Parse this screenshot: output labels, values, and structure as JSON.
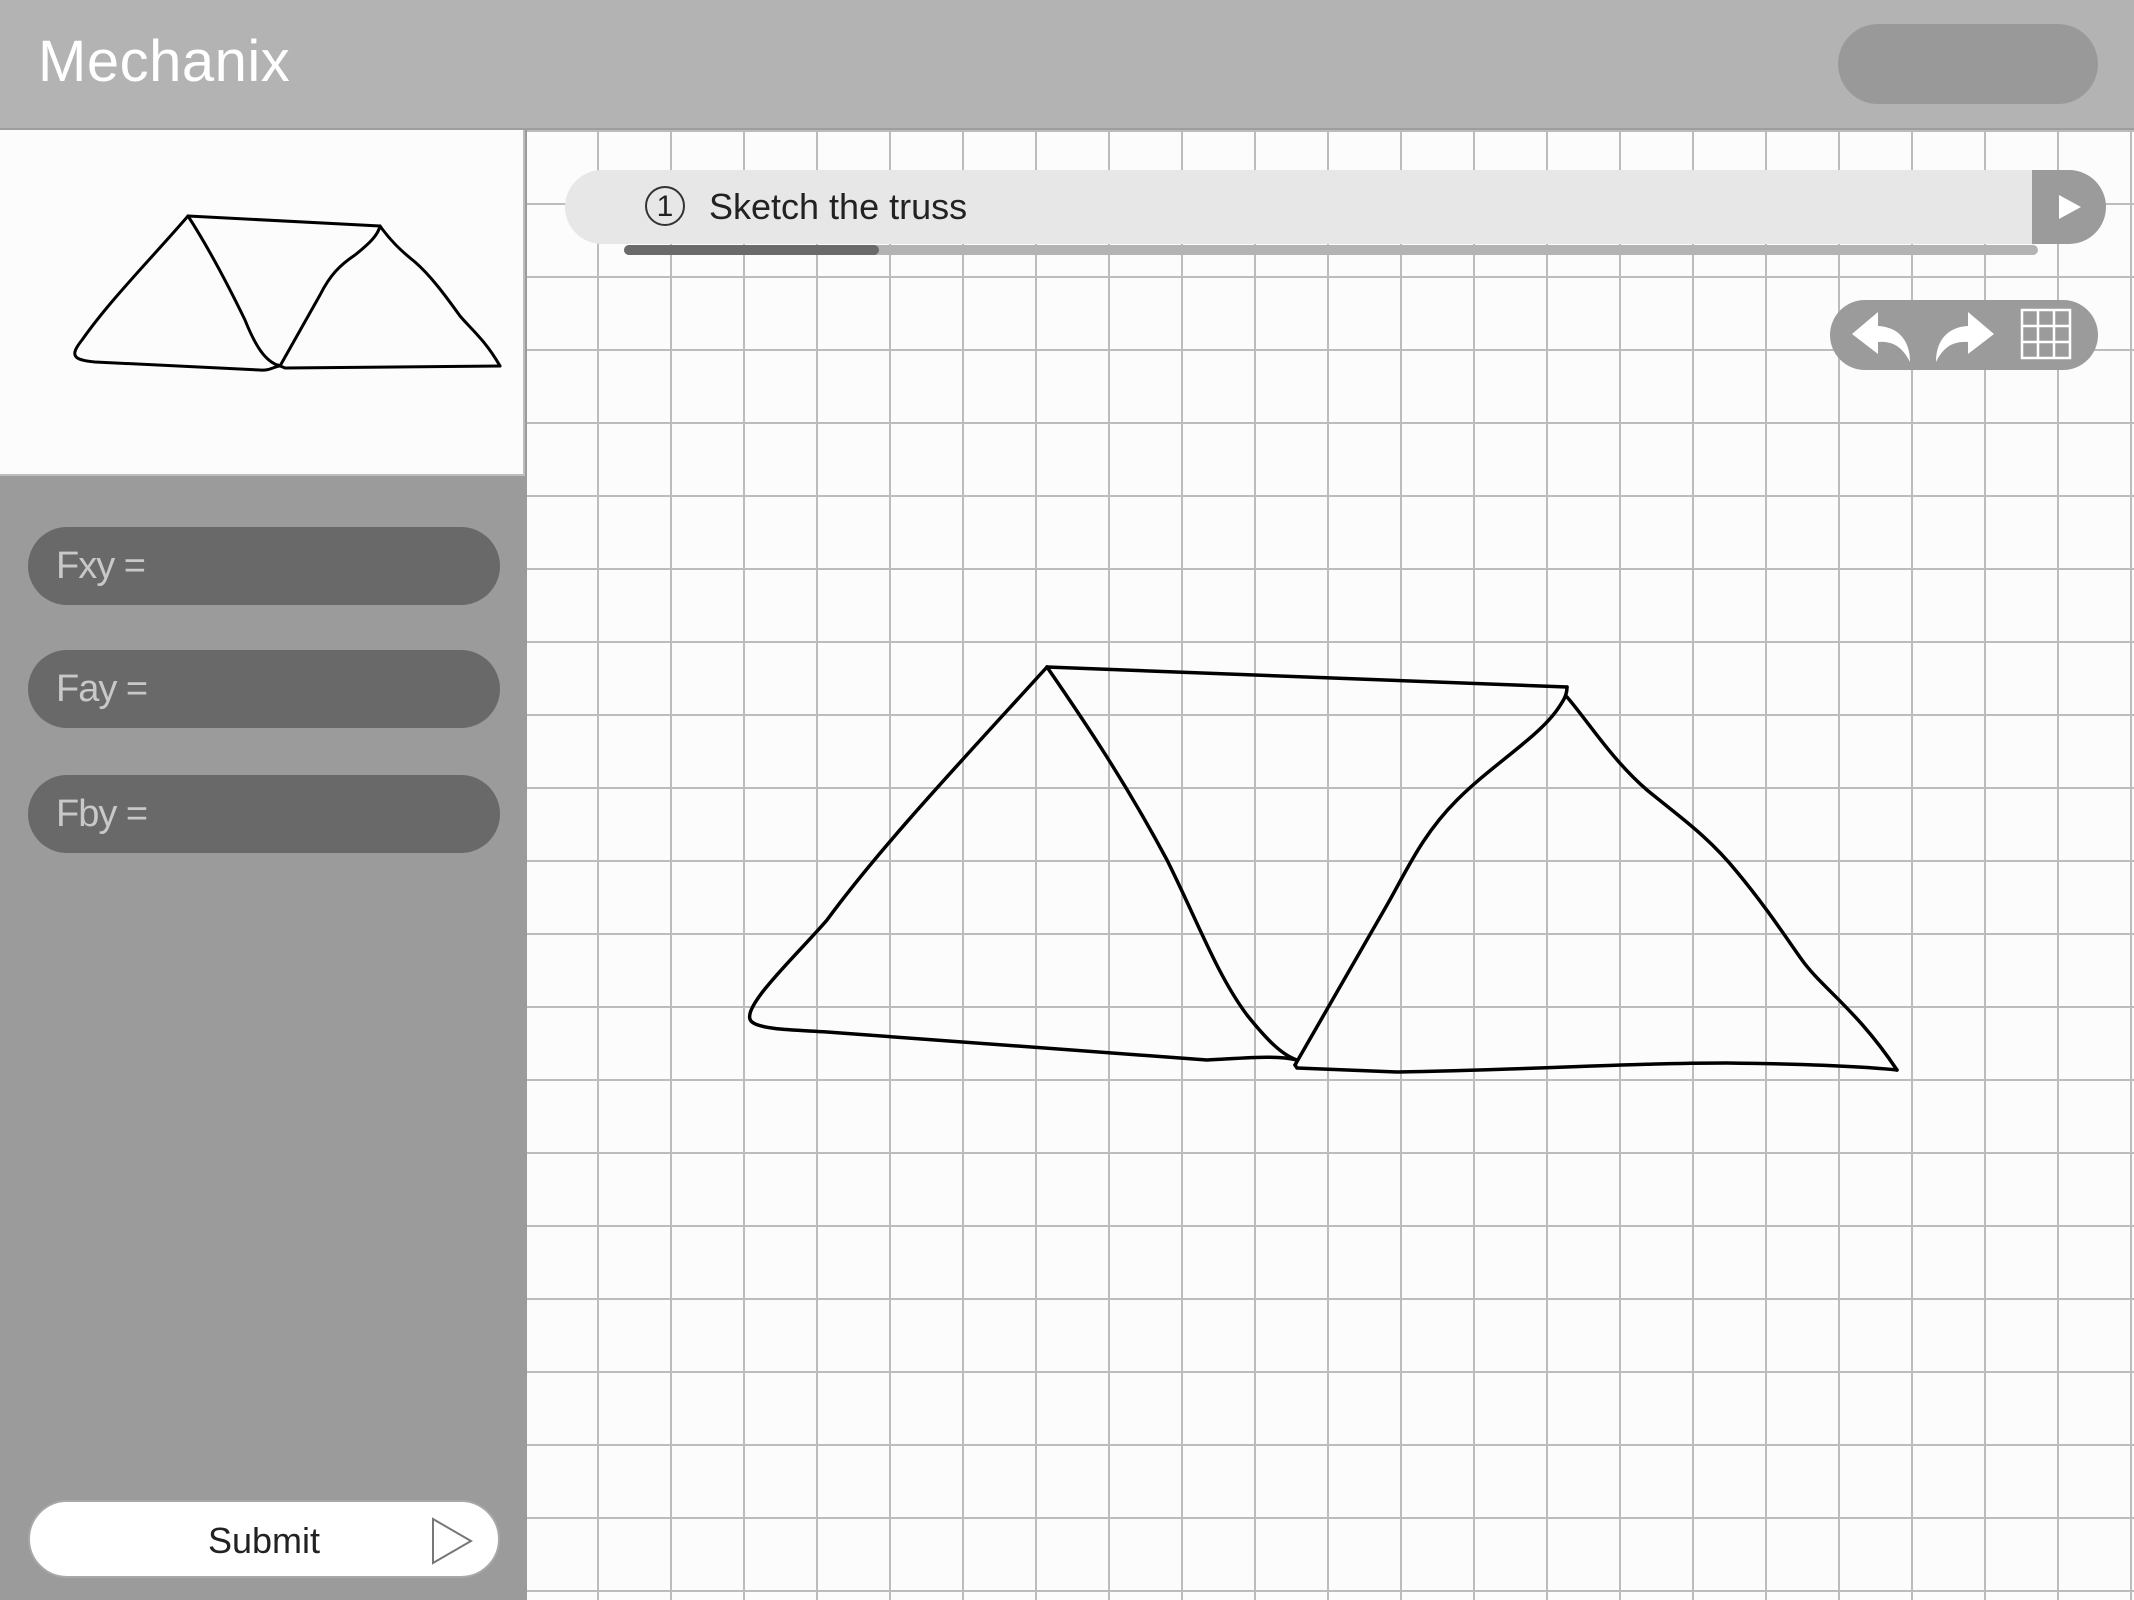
{
  "header": {
    "app_title": "Mechanix",
    "header_button_label": ""
  },
  "sidebar": {
    "fields": [
      {
        "label": "Fxy =",
        "value": ""
      },
      {
        "label": "Fay =",
        "value": ""
      },
      {
        "label": "Fby =",
        "value": ""
      }
    ],
    "submit_label": "Submit"
  },
  "step": {
    "number": "1",
    "text": "Sketch the truss",
    "progress_fraction": 0.18
  },
  "tools": [
    "undo-icon",
    "redo-icon",
    "grid-icon"
  ],
  "colors": {
    "header": "#b3b3b3",
    "sidebar": "#9b9b9b",
    "field": "#696969",
    "canvas": "#fbfcfb",
    "grid": "#bcbcbc",
    "progress": "#6a6a6a"
  }
}
